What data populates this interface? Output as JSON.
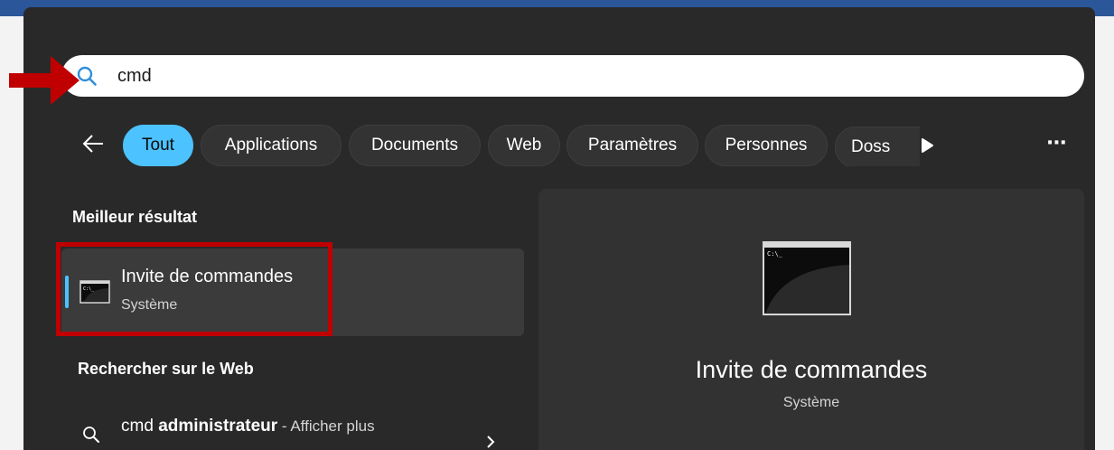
{
  "search": {
    "query": "cmd"
  },
  "filters": {
    "chips": [
      "Tout",
      "Applications",
      "Documents",
      "Web",
      "Paramètres",
      "Personnes",
      "Doss"
    ],
    "active": "Tout"
  },
  "left": {
    "best_match_heading": "Meilleur résultat",
    "best_match": {
      "title": "Invite de commandes",
      "subtitle": "Système"
    },
    "web_heading": "Rechercher sur le Web",
    "web_result": {
      "query_prefix": "cmd",
      "query_bold": "administrateur",
      "hint": " - Afficher plus"
    }
  },
  "preview": {
    "title": "Invite de commandes",
    "subtitle": "Système"
  },
  "colors": {
    "accent": "#4cc2ff",
    "panel": "#292929",
    "annotation": "#c00000"
  }
}
